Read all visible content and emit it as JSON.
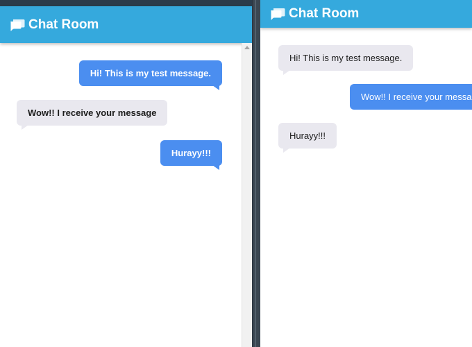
{
  "left_window": {
    "title": "Chat Room",
    "title_icon": "chat-bubbles-icon",
    "messages": [
      {
        "text": "Hi! This is my test message.",
        "type": "sent"
      },
      {
        "text": "Wow!! I receive your message",
        "type": "received"
      },
      {
        "text": "Hurayy!!!",
        "type": "sent"
      }
    ]
  },
  "right_window": {
    "title": "Chat Room",
    "title_icon": "chat-bubbles-icon",
    "messages": [
      {
        "text": "Hi! This is my test message.",
        "type": "received"
      },
      {
        "text": "Wow!! I receive your messa",
        "type": "sent"
      },
      {
        "text": "Hurayy!!!",
        "type": "received"
      }
    ]
  },
  "colors": {
    "header": "#35a9dd",
    "sent_bubble": "#4b8ef0",
    "received_bubble": "#e9e8ef",
    "background": "#3a4651"
  }
}
